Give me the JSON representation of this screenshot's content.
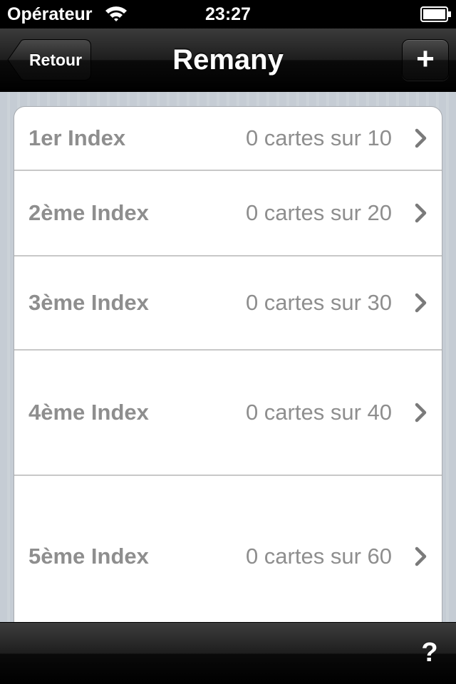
{
  "status_bar": {
    "carrier": "Opérateur",
    "time": "23:27",
    "wifi_icon": "wifi-icon",
    "battery_icon": "battery-icon"
  },
  "nav": {
    "back_label": "Retour",
    "title": "Remany",
    "add_label": "+",
    "add_icon": "plus-icon"
  },
  "rows": [
    {
      "title": "1er Index",
      "detail": "0 cartes sur 10"
    },
    {
      "title": "2ème Index",
      "detail": "0 cartes sur 20"
    },
    {
      "title": "3ème Index",
      "detail": "0 cartes sur 30"
    },
    {
      "title": "4ème Index",
      "detail": "0 cartes sur 40"
    },
    {
      "title": "5ème Index",
      "detail": "0 cartes sur 60"
    }
  ],
  "toolbar": {
    "help_label": "?"
  },
  "colors": {
    "row_text": "#8e8e8e",
    "background": "#c5ccd4",
    "bar": "#000000"
  }
}
